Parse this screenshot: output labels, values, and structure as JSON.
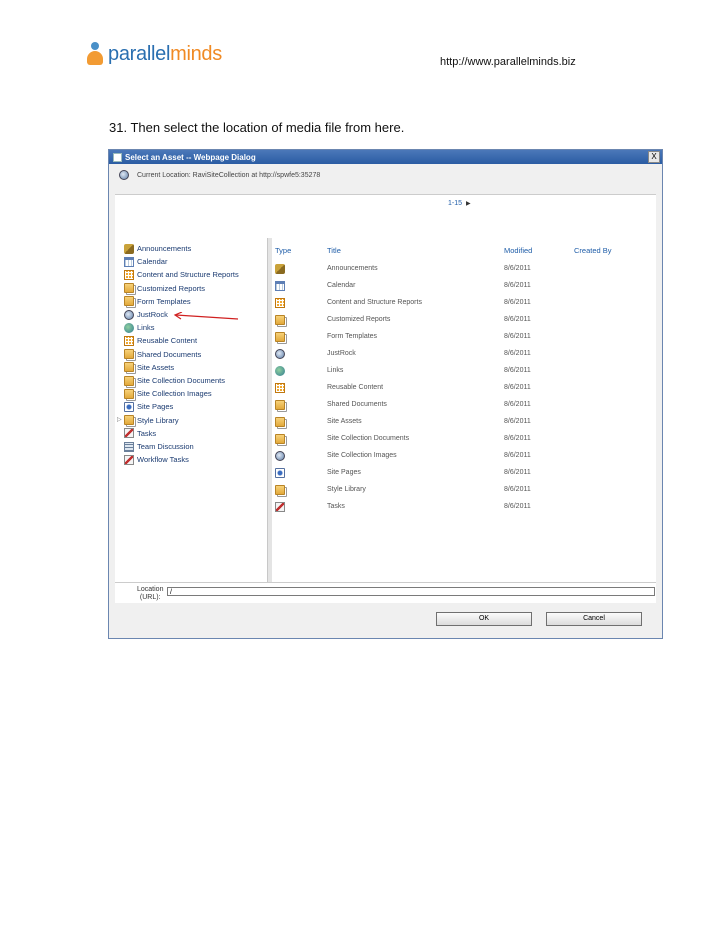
{
  "header": {
    "logo_text_a": "parallel",
    "logo_text_b": "minds",
    "url": "http://www.parallelminds.biz"
  },
  "step_text": "31. Then select the location of media file from here.",
  "dialog": {
    "title": "Select an Asset -- Webpage Dialog",
    "close_label": "X",
    "current_location": "Current Location: RaviSiteCollection at http://spwfe5:35278",
    "pager": "1-15",
    "columns": {
      "type": "Type",
      "title": "Title",
      "modified": "Modified",
      "created_by": "Created By"
    },
    "tree": [
      {
        "label": "Announcements",
        "icon": "announcements-icon"
      },
      {
        "label": "Calendar",
        "icon": "calendar-icon"
      },
      {
        "label": "Content and Structure Reports",
        "icon": "list-icon"
      },
      {
        "label": "Customized Reports",
        "icon": "document-library-icon"
      },
      {
        "label": "Form Templates",
        "icon": "document-library-icon"
      },
      {
        "label": "JustRock",
        "icon": "site-icon"
      },
      {
        "label": "Links",
        "icon": "links-icon"
      },
      {
        "label": "Reusable Content",
        "icon": "list-icon"
      },
      {
        "label": "Shared Documents",
        "icon": "document-library-icon"
      },
      {
        "label": "Site Assets",
        "icon": "document-library-icon"
      },
      {
        "label": "Site Collection Documents",
        "icon": "document-library-icon"
      },
      {
        "label": "Site Collection Images",
        "icon": "document-library-icon"
      },
      {
        "label": "Site Pages",
        "icon": "site-pages-icon"
      },
      {
        "label": "Style Library",
        "icon": "document-library-icon"
      },
      {
        "label": "Tasks",
        "icon": "tasks-icon"
      },
      {
        "label": "Team Discussion",
        "icon": "discussion-icon"
      },
      {
        "label": "Workflow Tasks",
        "icon": "tasks-icon"
      }
    ],
    "rows": [
      {
        "title": "Announcements",
        "modified": "8/6/2011",
        "icon": "announcements-icon"
      },
      {
        "title": "Calendar",
        "modified": "8/6/2011",
        "icon": "calendar-icon"
      },
      {
        "title": "Content and Structure Reports",
        "modified": "8/6/2011",
        "icon": "list-icon"
      },
      {
        "title": "Customized Reports",
        "modified": "8/6/2011",
        "icon": "document-library-icon"
      },
      {
        "title": "Form Templates",
        "modified": "8/6/2011",
        "icon": "document-library-icon"
      },
      {
        "title": "JustRock",
        "modified": "8/6/2011",
        "icon": "site-icon"
      },
      {
        "title": "Links",
        "modified": "8/6/2011",
        "icon": "links-icon"
      },
      {
        "title": "Reusable Content",
        "modified": "8/6/2011",
        "icon": "list-icon"
      },
      {
        "title": "Shared Documents",
        "modified": "8/6/2011",
        "icon": "document-library-icon"
      },
      {
        "title": "Site Assets",
        "modified": "8/6/2011",
        "icon": "document-library-icon"
      },
      {
        "title": "Site Collection Documents",
        "modified": "8/6/2011",
        "icon": "document-library-icon"
      },
      {
        "title": "Site Collection Images",
        "modified": "8/6/2011",
        "icon": "site-icon"
      },
      {
        "title": "Site Pages",
        "modified": "8/6/2011",
        "icon": "site-pages-icon"
      },
      {
        "title": "Style Library",
        "modified": "8/6/2011",
        "icon": "document-library-icon"
      },
      {
        "title": "Tasks",
        "modified": "8/6/2011",
        "icon": "tasks-icon"
      }
    ],
    "location_label_1": "Location",
    "location_label_2": "(URL):",
    "location_value": "/",
    "ok_label": "OK",
    "cancel_label": "Cancel",
    "colors": {
      "titlebar": "#2a5ca3",
      "link": "#1f5da8",
      "annotation_arrow": "#d02020"
    }
  }
}
